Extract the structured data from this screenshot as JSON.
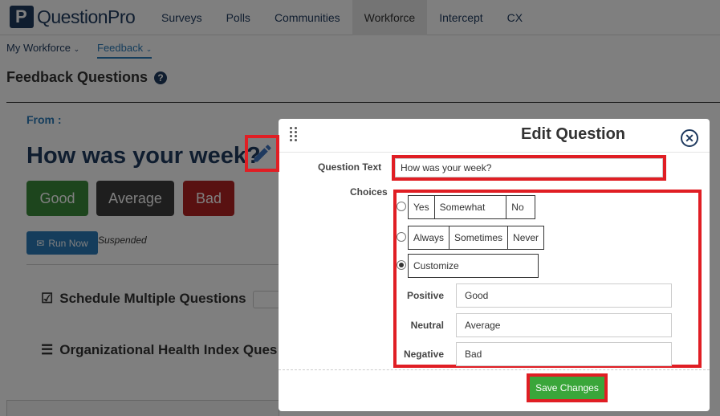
{
  "topnav": {
    "logo_text": "QuestionPro",
    "tabs": [
      {
        "label": "Surveys"
      },
      {
        "label": "Polls"
      },
      {
        "label": "Communities"
      },
      {
        "label": "Workforce"
      },
      {
        "label": "Intercept"
      },
      {
        "label": "CX"
      }
    ],
    "active_tab": "Workforce"
  },
  "subnav": {
    "items": [
      {
        "label": "My Workforce"
      },
      {
        "label": "Feedback"
      }
    ],
    "active": "Feedback"
  },
  "page": {
    "title": "Feedback Questions",
    "from_label": "From :",
    "question": "How was your week?",
    "choice_buttons": [
      {
        "label": "Good",
        "color": "#3a8a3a"
      },
      {
        "label": "Average",
        "color": "#3c3c3c"
      },
      {
        "label": "Bad",
        "color": "#b22222"
      }
    ],
    "run_now_label": "Run Now",
    "status": "Suspended",
    "sections": [
      {
        "label": "Schedule Multiple Questions"
      },
      {
        "label": "Organizational Health Index Ques"
      }
    ]
  },
  "modal": {
    "title": "Edit Question",
    "close_icon": "close-icon",
    "question_text_label": "Question Text",
    "question_text_value": "How was your week?",
    "choices_label": "Choices",
    "choice_sets": [
      {
        "options": [
          "Yes",
          "Somewhat",
          "No"
        ],
        "selected": false
      },
      {
        "options": [
          "Always",
          "Sometimes",
          "Never"
        ],
        "selected": false
      },
      {
        "options": [
          "Customize"
        ],
        "selected": true
      }
    ],
    "sentiments": [
      {
        "label": "Positive",
        "value": "Good"
      },
      {
        "label": "Neutral",
        "value": "Average"
      },
      {
        "label": "Negative",
        "value": "Bad"
      }
    ],
    "save_label": "Save Changes"
  },
  "colors": {
    "brand": "#1f3a5f",
    "accent": "#2a7ab8",
    "highlight": "#e01e24",
    "save": "#3aa63a"
  }
}
